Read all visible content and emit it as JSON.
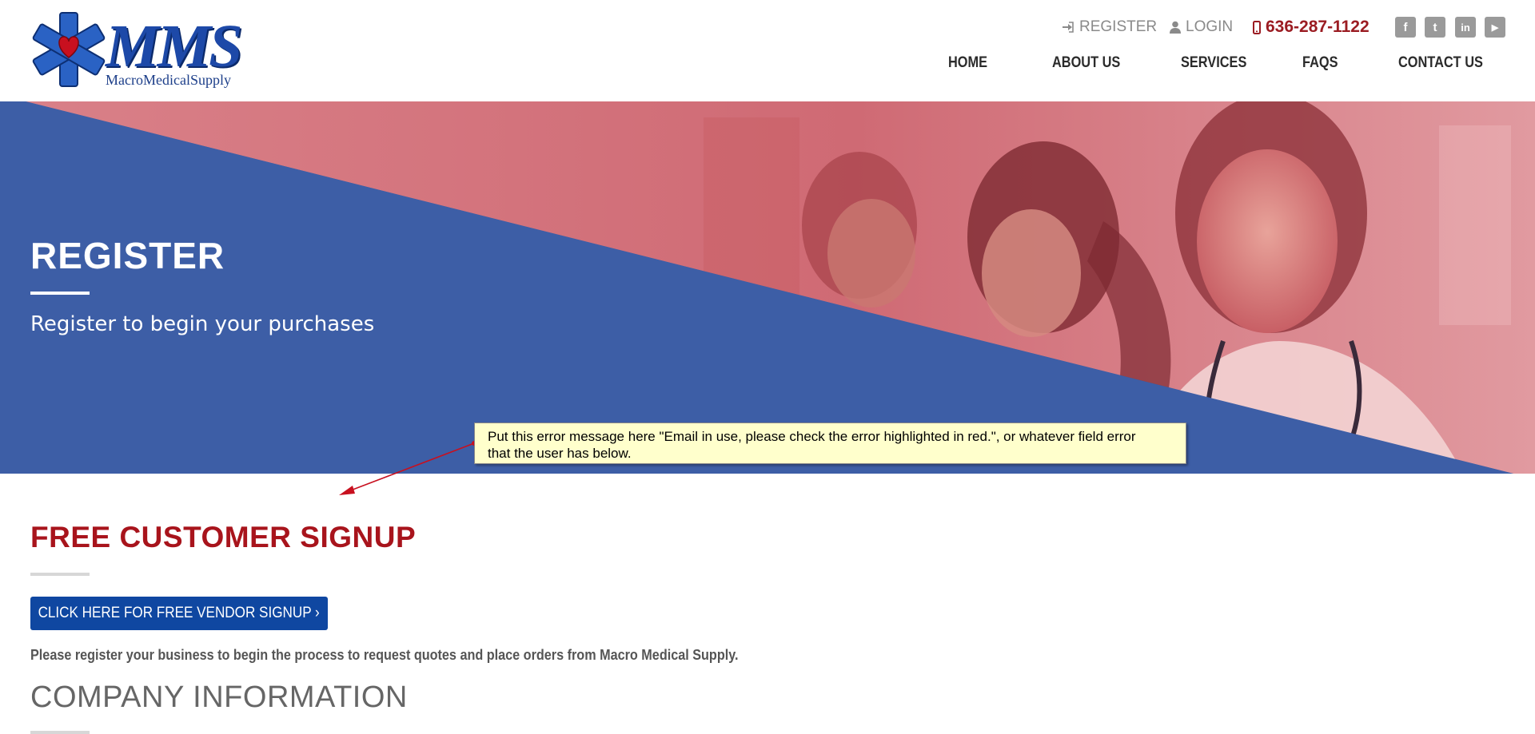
{
  "brand": {
    "logo_text": "MMS",
    "tagline": "MacroMedicalSupply"
  },
  "topbar": {
    "register_label": "REGISTER",
    "login_label": "LOGIN",
    "phone": "636-287-1122",
    "register_icon": "sign-in-icon",
    "login_icon": "user-icon",
    "phone_icon": "mobile-phone-icon",
    "social": [
      {
        "name": "facebook-icon",
        "glyph": "f"
      },
      {
        "name": "twitter-icon",
        "glyph": "t"
      },
      {
        "name": "linkedin-icon",
        "glyph": "in"
      },
      {
        "name": "youtube-icon",
        "glyph": "▶"
      }
    ]
  },
  "nav": {
    "items": [
      "HOME",
      "ABOUT US",
      "SERVICES",
      "FAQS",
      "CONTACT US"
    ]
  },
  "hero": {
    "title": "REGISTER",
    "subtitle": "Register to begin your purchases"
  },
  "annotation": {
    "line1": "Put this error message here \"Email in use, please check the error highlighted in red.\", or whatever field error",
    "line2": "that the user has below."
  },
  "content": {
    "signup_title": "FREE CUSTOMER SIGNUP",
    "vendor_button": "CLICK HERE FOR FREE VENDOR SIGNUP ›",
    "intro": "Please register your business to begin the process to request quotes and place orders from Macro Medical Supply.",
    "company_title": "COMPANY INFORMATION"
  },
  "colors": {
    "brand_blue": "#1d49a8",
    "hero_blue": "#3d5ea6",
    "hero_overlay_red": "#d98088",
    "accent_red": "#a8141c",
    "button_blue": "#0f47a1",
    "note_yellow": "#ffffcc"
  }
}
